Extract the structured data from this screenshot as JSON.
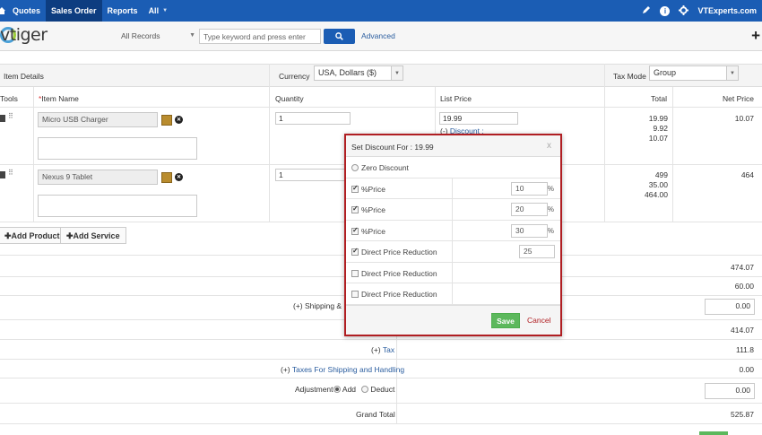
{
  "nav": {
    "items": [
      "Quotes",
      "Sales Order",
      "Reports",
      "All"
    ],
    "active": "Sales Order",
    "site": "VTExperts.com"
  },
  "header": {
    "logo_text": "vtiger",
    "records_select": "All Records",
    "keyword_placeholder": "Type keyword and press enter",
    "advanced": "Advanced"
  },
  "items": {
    "section_title": "Item Details",
    "currency_label": "Currency",
    "currency_value": "USA, Dollars ($)",
    "taxmode_label": "Tax Mode",
    "taxmode_value": "Group",
    "columns": {
      "tools": "Tools",
      "item_name": "Item Name",
      "required": "*",
      "quantity": "Quantity",
      "list_price": "List Price",
      "total": "Total",
      "net_price": "Net Price"
    },
    "rows": [
      {
        "name": "Micro USB Charger",
        "quantity": "1",
        "list_price": "19.99",
        "discount_link_prefix": "(-)",
        "discount_link": "Discount :",
        "totals": [
          "19.99",
          "9.92",
          "10.07"
        ],
        "net": "10.07"
      },
      {
        "name": "Nexus 9 Tablet",
        "quantity": "1",
        "list_price": "",
        "totals": [
          "499",
          "35.00",
          "464.00"
        ],
        "net": "464"
      }
    ],
    "add_product": "Add Product",
    "add_service": "Add Service"
  },
  "summary": {
    "rows": [
      {
        "label": "",
        "value": "474.07"
      },
      {
        "label": "",
        "value": "60.00"
      },
      {
        "label": "(+) Shipping & Ha",
        "value": "0.00",
        "input": true
      },
      {
        "label": "",
        "value": "414.07"
      },
      {
        "label_prefix": "(+)",
        "label_link": "Tax",
        "value": "111.8"
      },
      {
        "label_prefix": "(+)",
        "label_link": "Taxes For Shipping and Handling",
        "value": "0.00"
      },
      {
        "label": "Adjustment",
        "add": "Add",
        "deduct": "Deduct",
        "value": "0.00",
        "input": true
      },
      {
        "label": "Grand Total",
        "value": "525.87"
      }
    ]
  },
  "modal": {
    "title": "Set Discount For : 19.99",
    "close": "x",
    "rows": [
      {
        "type": "radio",
        "label": "Zero Discount"
      },
      {
        "type": "check",
        "checked": true,
        "label": "%Price",
        "value": "10",
        "suffix": "%"
      },
      {
        "type": "check",
        "checked": true,
        "label": "%Price",
        "value": "20",
        "suffix": "%"
      },
      {
        "type": "check",
        "checked": true,
        "label": "%Price",
        "value": "30",
        "suffix": "%"
      },
      {
        "type": "check",
        "checked": true,
        "label": "Direct Price Reduction",
        "value": "25"
      },
      {
        "type": "check",
        "checked": false,
        "label": "Direct Price Reduction"
      },
      {
        "type": "check",
        "checked": false,
        "label": "Direct Price Reduction"
      }
    ],
    "save": "Save",
    "cancel": "Cancel"
  },
  "colors": {
    "nav": "#1b5db4",
    "modal_border": "#b01e22",
    "save": "#5cb85c"
  }
}
